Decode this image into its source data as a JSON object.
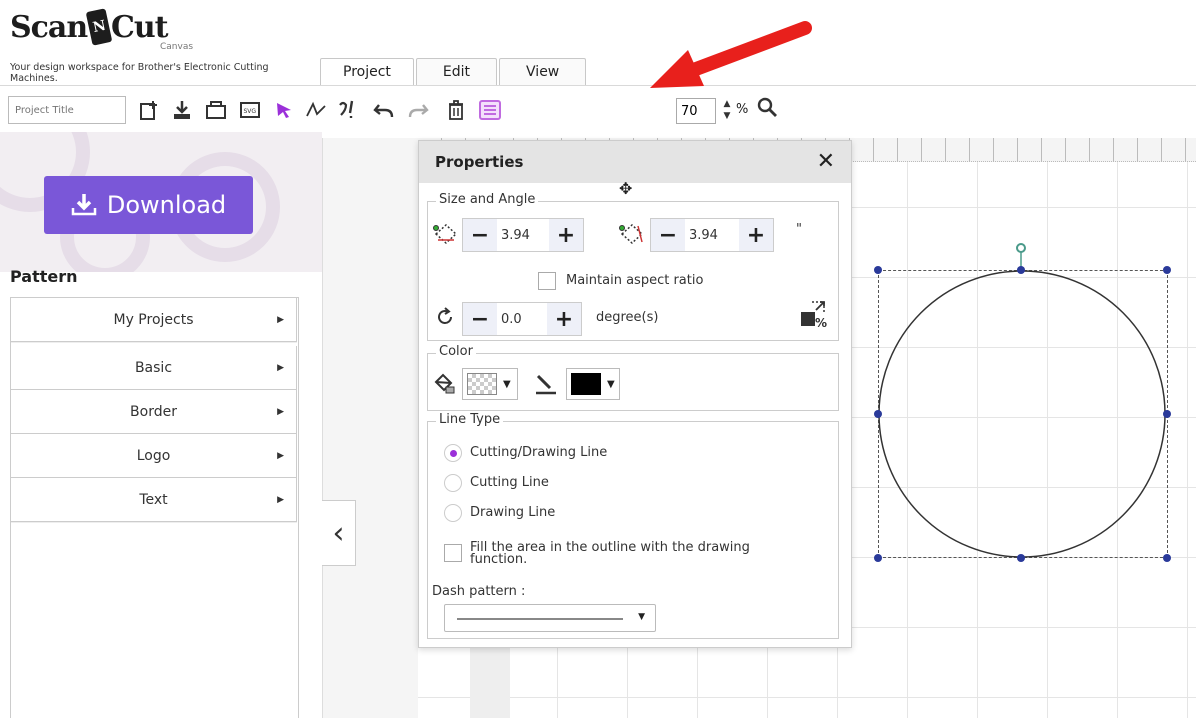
{
  "brand": {
    "logo_part1": "Scan",
    "logo_n": "N",
    "logo_part2": "Cut",
    "logo_sub": "Canvas",
    "tagline": "Your design workspace for Brother's Electronic Cutting Machines."
  },
  "tabs": [
    {
      "label": "Project"
    },
    {
      "label": "Edit"
    },
    {
      "label": "View"
    }
  ],
  "toolbar": {
    "project_title_placeholder": "Project Title",
    "zoom_value": "70",
    "zoom_unit": "%"
  },
  "download": {
    "label": "Download"
  },
  "pattern": {
    "heading": "Pattern",
    "items": [
      {
        "label": "My Projects"
      },
      {
        "label": "Basic"
      },
      {
        "label": "Border"
      },
      {
        "label": "Logo"
      },
      {
        "label": "Text"
      }
    ]
  },
  "properties": {
    "title": "Properties",
    "size_section": "Size and Angle",
    "width_value": "3.94",
    "height_value": "3.94",
    "unit_mark": "\"",
    "maintain_aspect": "Maintain aspect ratio",
    "angle_value": "0.0",
    "angle_unit": "degree(s)",
    "scale_label": "%",
    "color_section": "Color",
    "line_section": "Line Type",
    "line_options": [
      {
        "label": "Cutting/Drawing Line",
        "selected": true
      },
      {
        "label": "Cutting Line",
        "selected": false
      },
      {
        "label": "Drawing Line",
        "selected": false
      }
    ],
    "fill_label": "Fill the area in the outline with the drawing function.",
    "dash_label": "Dash pattern :"
  },
  "colors": {
    "accent_purple": "#9b30d9",
    "download_bg": "#7a57d8",
    "arrow_red": "#e8201c"
  }
}
